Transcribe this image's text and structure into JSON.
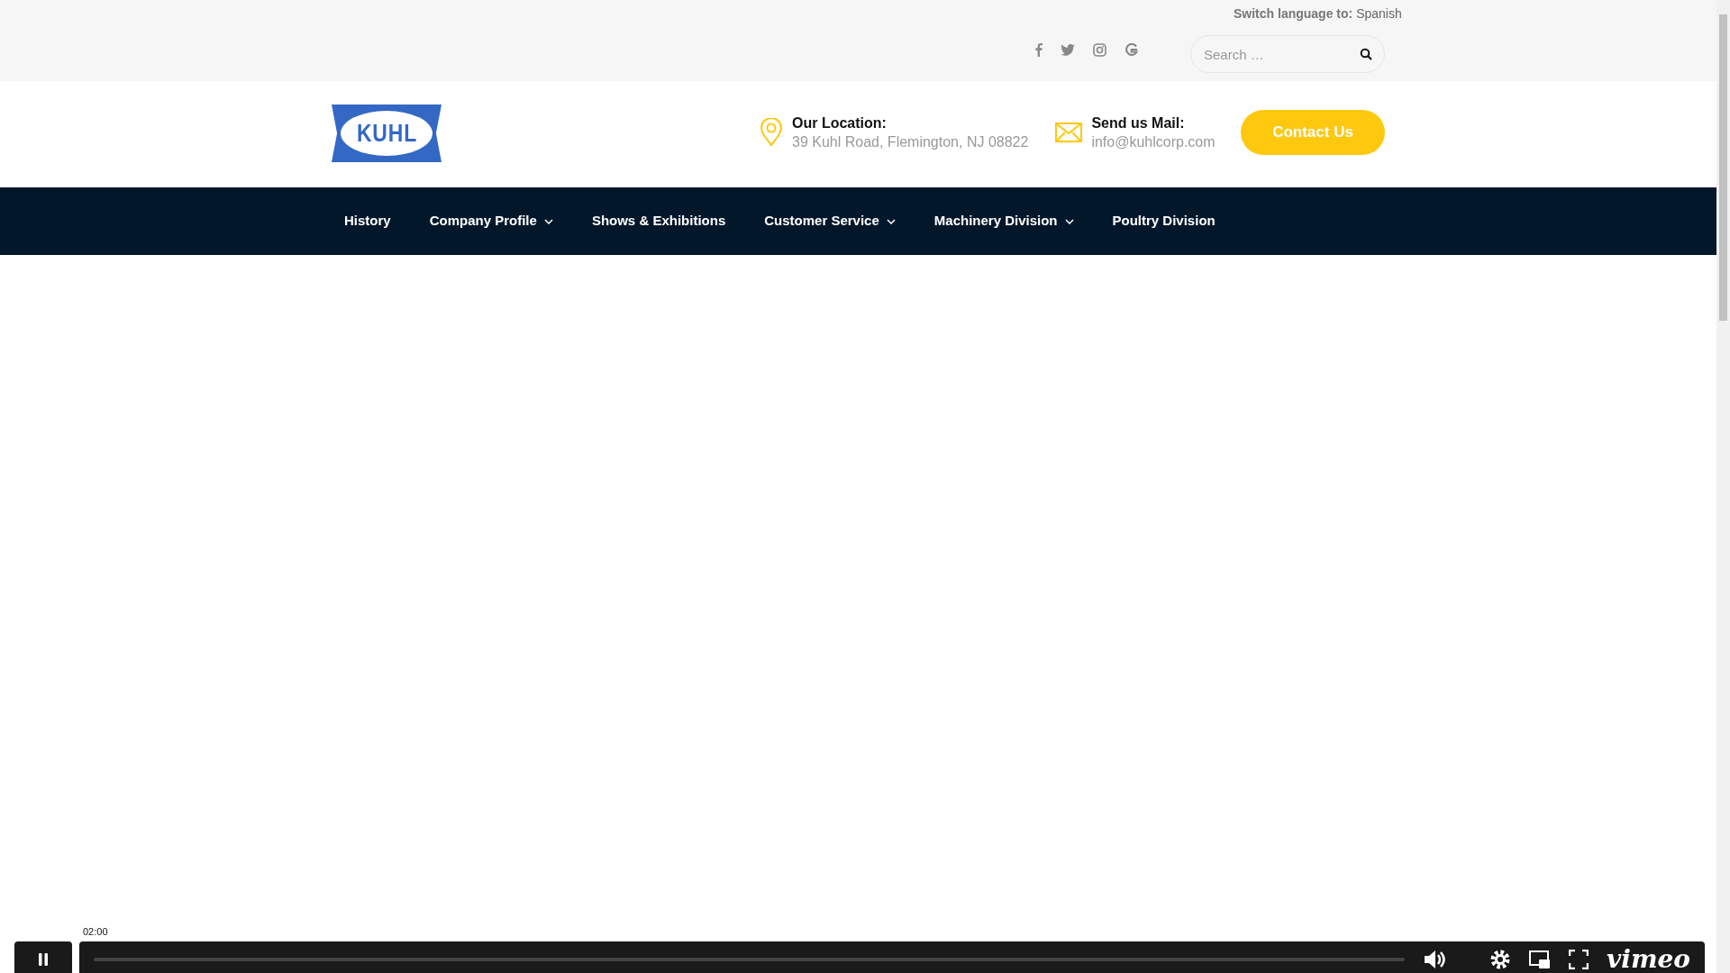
{
  "top_bar": {
    "language_label": "Switch language to:",
    "language_link": "Spanish",
    "social": [
      {
        "kind": "facebook"
      },
      {
        "kind": "twitter"
      },
      {
        "kind": "instagram"
      },
      {
        "kind": "google"
      }
    ],
    "search": {
      "placeholder": "Search …"
    }
  },
  "header": {
    "logo": "KUHL",
    "contacts": [
      {
        "kind": "location",
        "title": "Our Location:",
        "value": "39 Kuhl Road, Flemington, NJ 08822"
      },
      {
        "kind": "mail",
        "title": "Send us Mail:",
        "value": "info@kuhlcorp.com"
      }
    ],
    "button": "Contact Us"
  },
  "nav": [
    {
      "label": "History",
      "has_dropdown": false
    },
    {
      "label": "Company Profile",
      "has_dropdown": true
    },
    {
      "label": "Shows & Exhibitions",
      "has_dropdown": false
    },
    {
      "label": "Customer Service",
      "has_dropdown": true
    },
    {
      "label": "Machinery Division",
      "has_dropdown": true
    },
    {
      "label": "Poultry Division",
      "has_dropdown": false
    }
  ],
  "video_player": {
    "playing": true,
    "time": "02:00",
    "level": 0,
    "brand": "vimeo"
  }
}
